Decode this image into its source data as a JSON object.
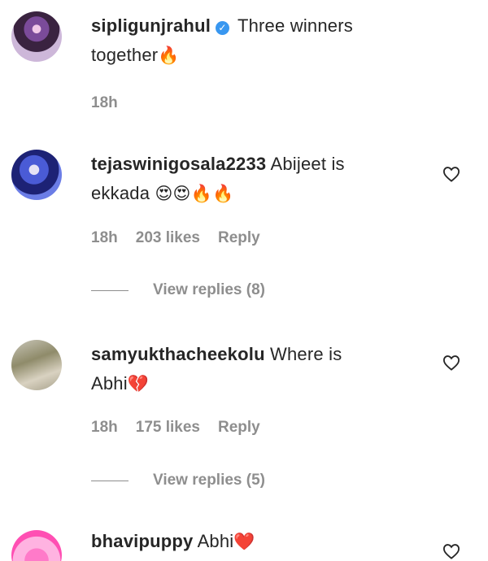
{
  "comments": [
    {
      "username": "sipligunjrahul",
      "verified_mark": "✓",
      "text_line1": "Three winners",
      "text_line2": "together",
      "emoji": "🔥",
      "time": "18h"
    },
    {
      "username": "tejaswinigosala2233",
      "text_line1": "Abijeet is",
      "text_line2": "ekkada",
      "emoji": "😍😍🔥🔥",
      "time": "18h",
      "likes": "203 likes",
      "reply": "Reply",
      "view_replies": "View replies (8)"
    },
    {
      "username": "samyukthacheekolu",
      "text_line1": "Where is",
      "text_line2": "Abhi",
      "emoji": "💔",
      "time": "18h",
      "likes": "175 likes",
      "reply": "Reply",
      "view_replies": "View replies (5)"
    },
    {
      "username": "bhavipuppy",
      "text_line1": "Abhi",
      "emoji": "❤️"
    }
  ],
  "icons": {
    "like": "heart-outline-icon",
    "verified": "verified-badge-icon"
  },
  "colors": {
    "username": "#262626",
    "meta": "#8e8e8e",
    "verified": "#3897f0"
  }
}
